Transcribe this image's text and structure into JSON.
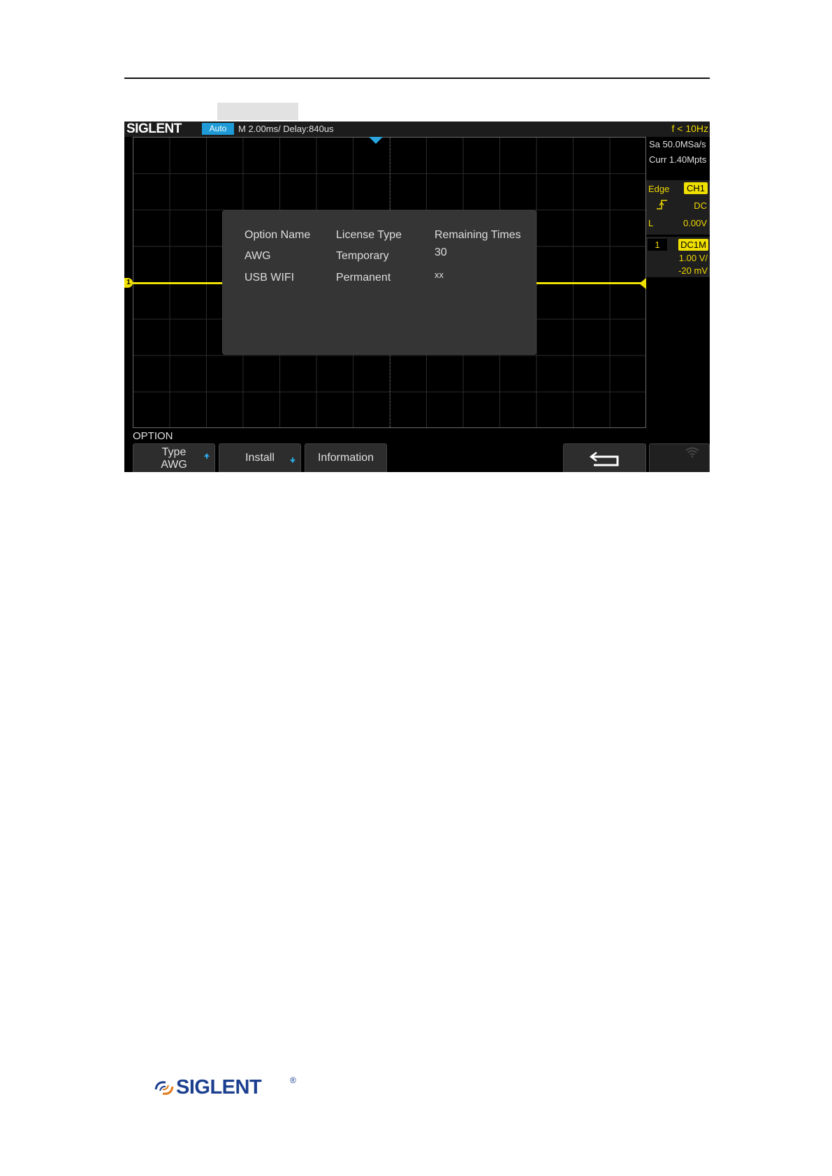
{
  "scope": {
    "brand": "SIGLENT",
    "status": {
      "trigger_mode": "Auto",
      "timebase": "M 2.00ms/ Delay:840us",
      "frequency": "f < 10Hz"
    },
    "side_panel": {
      "sample_rate": "Sa 50.0MSa/s",
      "memory": "Curr 1.40Mpts",
      "trigger": {
        "type": "Edge",
        "source": "CH1",
        "coupling": "DC",
        "level_label": "L",
        "level": "0.00V"
      },
      "channel": {
        "number": "1",
        "coupling": "DC1M",
        "scale": "1.00 V/",
        "offset": "-20 mV"
      }
    },
    "channel_marker": "1",
    "dialog": {
      "headers": [
        "Option Name",
        "License Type",
        "Remaining Times"
      ],
      "rows": [
        [
          "AWG",
          "Temporary",
          "30"
        ],
        [
          "USB WIFI",
          "Permanent",
          "xx"
        ]
      ]
    },
    "menu": {
      "title": "OPTION",
      "type_label": "Type",
      "type_value": "AWG",
      "install_label": "Install",
      "information_label": "Information"
    }
  },
  "footer": {
    "brand": "SIGLENT",
    "registered": "®"
  },
  "colors": {
    "trace": "#f0e000",
    "accent": "#1e9bd7",
    "brand_blue": "#1c3f8f"
  }
}
